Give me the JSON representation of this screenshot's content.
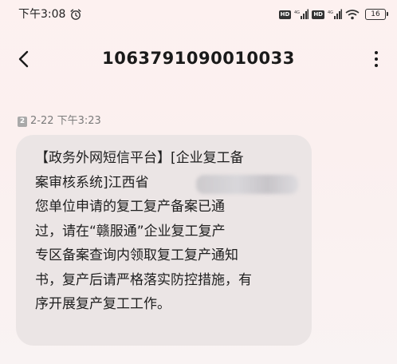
{
  "status_bar": {
    "time": "下午3:08",
    "alarm_icon": "alarm-clock-icon",
    "network_badge_1": "HD",
    "network_badge_2": "HD",
    "battery_level": "16"
  },
  "header": {
    "back_icon": "chevron-left-icon",
    "title": "1063791090010033",
    "more_icon": "more-vertical-icon"
  },
  "message": {
    "sim_slot": "2",
    "timestamp": "2-22 下午3:23",
    "lines": [
      "【政务外网短信平台】[企业复工备",
      "案审核系统]江西省",
      "您单位申请的复工复产备案已通",
      "过，请在“赣服通”企业复工复产",
      "专区备案查询内领取复工复产通知",
      "书，复产后请严格落实防控措施，有",
      "序开展复产复工工作。"
    ]
  },
  "colors": {
    "background": "#fbf0ef",
    "bubble": "#ebe5e5",
    "meta_text": "#7b7b7b"
  }
}
